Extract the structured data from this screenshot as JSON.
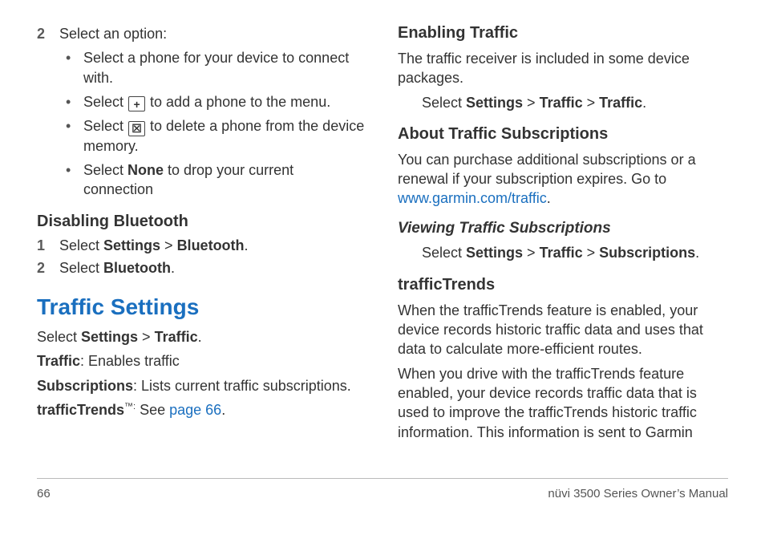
{
  "left": {
    "step2_label": "2",
    "step2_intro": "Select an option:",
    "bullets": {
      "b1": "Select a phone for your device to connect with.",
      "b2_pre": "Select ",
      "b2_icon_glyph": "+",
      "b2_post": " to add a phone to the menu.",
      "b3_pre": "Select ",
      "b3_icon_glyph": "☒",
      "b3_post": " to delete a phone from the device memory.",
      "b4_pre": "Select ",
      "b4_bold": "None",
      "b4_post": " to drop your current connection"
    },
    "disabling_head": "Disabling Bluetooth",
    "db_step1_n": "1",
    "db_step1_pre": "Select ",
    "db_step1_b1": "Settings",
    "db_step1_gt1": " > ",
    "db_step1_b2": "Bluetooth",
    "db_step1_end": ".",
    "db_step2_n": "2",
    "db_step2_pre": "Select ",
    "db_step2_b1": "Bluetooth",
    "db_step2_end": ".",
    "traffic_settings_title": "Traffic Settings",
    "ts_line_pre": "Select ",
    "ts_line_b1": "Settings",
    "ts_line_gt": " > ",
    "ts_line_b2": "Traffic",
    "ts_line_end": ".",
    "ts_traffic_b": "Traffic",
    "ts_traffic_post": ": Enables traffic",
    "ts_subs_b": "Subscriptions",
    "ts_subs_post": ": Lists current traffic subscriptions.",
    "ts_tt_b": "trafficTrends",
    "ts_tt_tm": "™:",
    "ts_tt_post_pre": " See ",
    "ts_tt_link": "page 66",
    "ts_tt_post_end": "."
  },
  "right": {
    "enabling_head": "Enabling Traffic",
    "enabling_para": "The traffic receiver is included in some device packages.",
    "en_sel_pre": "Select ",
    "en_sel_b1": "Settings",
    "en_sel_gt1": " > ",
    "en_sel_b2": "Traffic",
    "en_sel_gt2": " > ",
    "en_sel_b3": "Traffic",
    "en_sel_end": ".",
    "about_head": "About Traffic Subscriptions",
    "about_para_pre": "You can purchase additional subscriptions or a renewal if your subscription expires. Go to ",
    "about_link": "www.garmin.com/traffic",
    "about_para_end": ".",
    "viewing_head": "Viewing Traffic Subscriptions",
    "vw_sel_pre": "Select ",
    "vw_sel_b1": "Settings",
    "vw_sel_gt1": " > ",
    "vw_sel_b2": "Traffic",
    "vw_sel_gt2": " > ",
    "vw_sel_b3": "Subscriptions",
    "vw_sel_end": ".",
    "tt_head": "trafficTrends",
    "tt_para1": "When the trafficTrends feature is enabled, your device records historic traffic data and uses that data to calculate more-efficient routes.",
    "tt_para2": "When you drive with the trafficTrends feature enabled, your device records traffic data that is used to improve the trafficTrends historic traffic information. This information is sent to Garmin"
  },
  "footer": {
    "page_num": "66",
    "manual": "nüvi 3500 Series Owner’s Manual"
  }
}
